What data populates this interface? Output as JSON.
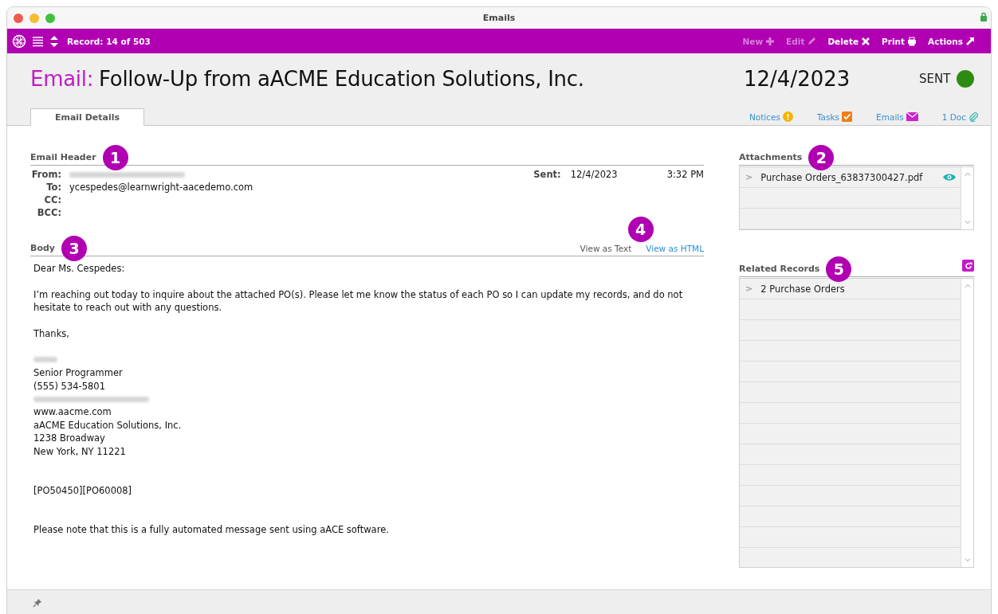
{
  "window": {
    "title": "Emails"
  },
  "toolbar": {
    "record": "Record: 14 of 503",
    "actions": [
      {
        "label": "New",
        "kind": "plus",
        "disabled": true
      },
      {
        "label": "Edit",
        "kind": "pencil",
        "disabled": true
      },
      {
        "label": "Delete",
        "kind": "cross",
        "disabled": false
      },
      {
        "label": "Print",
        "kind": "printer",
        "disabled": false
      },
      {
        "label": "Actions",
        "kind": "arrow",
        "disabled": false
      }
    ]
  },
  "header": {
    "prefix": "Email:",
    "title": "Follow-Up from aACME Education Solutions, Inc.",
    "date": "12/4/2023",
    "status": "SENT"
  },
  "tabs": [
    {
      "label": "Email Details",
      "selected": true
    }
  ],
  "links": [
    {
      "label": "Notices",
      "kind": "alert"
    },
    {
      "label": "Tasks",
      "kind": "task"
    },
    {
      "label": "Emails",
      "kind": "mail"
    },
    {
      "label": "1 Doc",
      "kind": "clip"
    }
  ],
  "email_header": {
    "heading": "Email Header",
    "callout": "1",
    "fields": [
      {
        "label": "From:",
        "kind": "redacted"
      },
      {
        "label": "To:",
        "value": "ycespedes@learnwright-aacedemo.com",
        "kind": "text"
      },
      {
        "label": "CC:",
        "kind": "text"
      },
      {
        "label": "BCC:",
        "kind": "text"
      }
    ],
    "sent_label": "Sent:",
    "sent_date": "12/4/2023",
    "sent_time": "3:32 PM"
  },
  "body": {
    "heading": "Body",
    "callout": "3",
    "view_callout": "4",
    "views": [
      {
        "label": "View as Text",
        "selected": false
      },
      {
        "label": "View as HTML",
        "selected": true
      }
    ],
    "lines": [
      {
        "kind": "text",
        "text": "Dear Ms. Cespedes:"
      },
      {
        "kind": "blank"
      },
      {
        "kind": "text",
        "text": "I’m reaching out today to inquire about the attached PO(s). Please let me know the status of each PO so I can update my records, and do not hesitate to reach out with any questions."
      },
      {
        "kind": "blank"
      },
      {
        "kind": "text",
        "text": "Thanks,"
      },
      {
        "kind": "blank"
      },
      {
        "kind": "redacted"
      },
      {
        "kind": "text",
        "text": "Senior Programmer"
      },
      {
        "kind": "text",
        "text": "(555) 534-5801"
      },
      {
        "kind": "redacted"
      },
      {
        "kind": "text",
        "text": "www.aacme.com"
      },
      {
        "kind": "text",
        "text": "aACME Education Solutions, Inc."
      },
      {
        "kind": "text",
        "text": "1238 Broadway"
      },
      {
        "kind": "text",
        "text": "New York, NY 11221"
      },
      {
        "kind": "blank"
      },
      {
        "kind": "blank"
      },
      {
        "kind": "text",
        "text": "[PO50450][PO60008]"
      },
      {
        "kind": "blank"
      },
      {
        "kind": "blank"
      },
      {
        "kind": "text",
        "text": "Please note that this is a fully automated message sent using aACE software."
      }
    ]
  },
  "attachments": {
    "heading": "Attachments",
    "callout": "2",
    "rows": [
      {
        "expander": ">",
        "name": "Purchase Orders_63837300427.pdf"
      }
    ]
  },
  "related_records": {
    "heading": "Related Records",
    "callout": "5",
    "rows": [
      {
        "expander": ">",
        "name": "2 Purchase Orders"
      }
    ]
  }
}
